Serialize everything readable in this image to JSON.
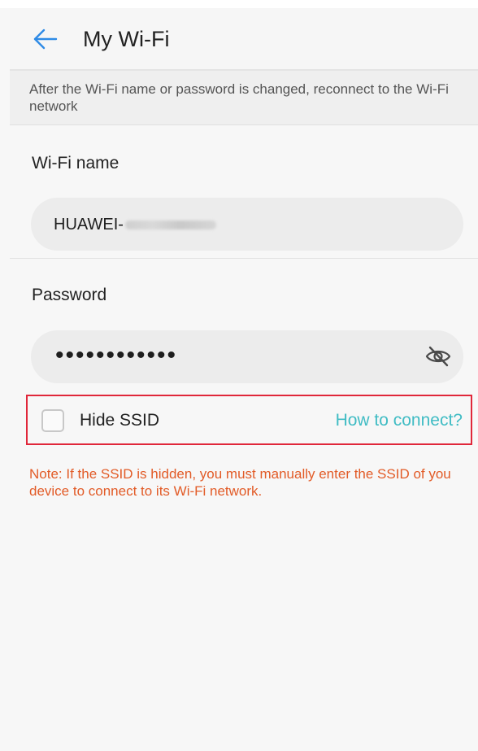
{
  "header": {
    "title": "My Wi-Fi",
    "back_icon": "arrow-left-icon",
    "accent_color": "#2f8be6"
  },
  "notice": {
    "text": "After the Wi-Fi name or password is changed, reconnect to the Wi-Fi network"
  },
  "wifi_name": {
    "label": "Wi-Fi name",
    "value_visible": "HUAWEI-",
    "value_suffix_obscured": true
  },
  "password": {
    "label": "Password",
    "value_masked": "••••••••••••",
    "toggle_icon": "eye-off-icon"
  },
  "hide_ssid": {
    "label": "Hide SSID",
    "checked": false,
    "help_link": "How to connect?",
    "highlight_color": "#e0273a",
    "link_color": "#40bcc4"
  },
  "note": {
    "text": "Note: If the SSID is hidden, you must manually enter the SSID of you device to connect to its Wi-Fi network.",
    "color": "#e25b27"
  }
}
